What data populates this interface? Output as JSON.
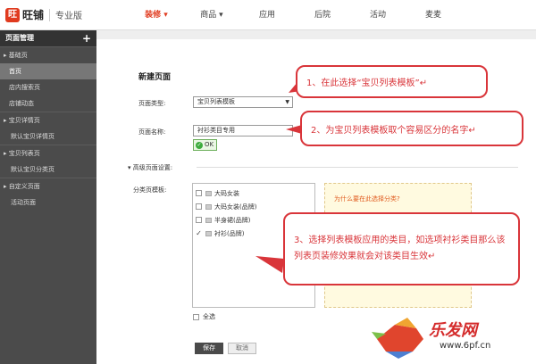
{
  "header": {
    "logo_text": "旺铺",
    "edition": "专业版",
    "nav": [
      {
        "label": "装修 ▾",
        "active": true
      },
      {
        "label": "商品 ▾",
        "active": false
      },
      {
        "label": "应用",
        "active": false
      },
      {
        "label": "后院",
        "active": false
      },
      {
        "label": "活动",
        "active": false
      },
      {
        "label": "麦麦",
        "active": false
      }
    ]
  },
  "sidebar": {
    "title": "页面管理",
    "plus": "+",
    "sections": [
      {
        "label": "▸ 基础页",
        "items": [
          {
            "label": "首页",
            "active": true
          },
          {
            "label": "店内搜索页",
            "active": false
          },
          {
            "label": "店铺动态",
            "active": false
          }
        ]
      },
      {
        "label": "▸ 宝贝详情页",
        "items": [
          {
            "label": "默认宝贝详情页",
            "active": false
          }
        ]
      },
      {
        "label": "▸ 宝贝列表页",
        "items": [
          {
            "label": "默认宝贝分类页",
            "active": false
          }
        ]
      },
      {
        "label": "▸ 自定义页面",
        "items": [
          {
            "label": "活动页面",
            "active": false
          }
        ]
      }
    ]
  },
  "form": {
    "title": "新建页面",
    "type_label": "页面类型:",
    "type_value": "宝贝列表模板",
    "name_label": "页面名称:",
    "name_value": "衬衫类目专用",
    "ok_text": "OK",
    "advanced_label": "▾ 高级页面设置:",
    "category_label": "分类页模板:",
    "categories": [
      {
        "label": "大码女装",
        "checked": false
      },
      {
        "label": "大码女装(品牌)",
        "checked": false
      },
      {
        "label": "半身裙(品牌)",
        "checked": false
      },
      {
        "label": "衬衫(品牌)",
        "checked": true
      }
    ],
    "tip_title": "为什么要在此选择分类?",
    "select_all": "全选",
    "save": "保存",
    "cancel": "取消"
  },
  "callouts": {
    "c1": "1、在此选择“宝贝列表模板”↵",
    "c2": "2、为宝贝列表模板取个容易区分的名字↵",
    "c3": "3、选择列表模板应用的类目，如选项衬衫类目那么该列表页装修效果就会对该类目生效↵"
  },
  "watermark": {
    "title": "乐发网",
    "url": "www.6pf.cn"
  },
  "colors": {
    "accent": "#e03a1e",
    "callout": "#d9353a",
    "sidebar": "#4b4b4b"
  }
}
